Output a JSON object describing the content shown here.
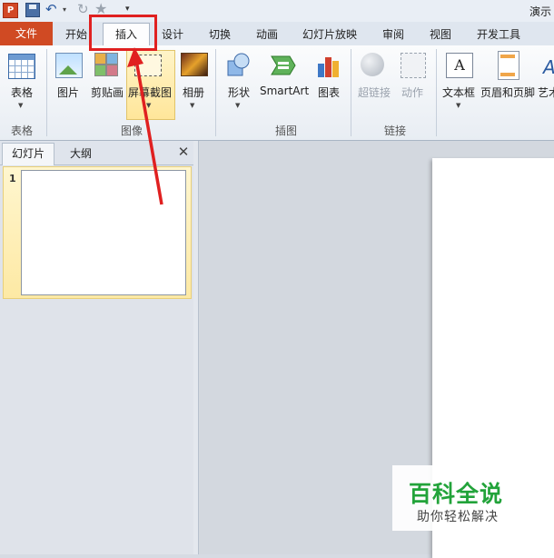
{
  "app": {
    "logo_letter": "P",
    "title": "演示"
  },
  "qat": {
    "undo_icon": "↶",
    "undo_dropdown_icon": "▾",
    "redo_icon": "↻",
    "star_icon": "★",
    "customize_icon": "▾"
  },
  "tabs": [
    {
      "label": "文件"
    },
    {
      "label": "开始"
    },
    {
      "label": "插入"
    },
    {
      "label": "设计"
    },
    {
      "label": "切换"
    },
    {
      "label": "动画"
    },
    {
      "label": "幻灯片放映"
    },
    {
      "label": "审阅"
    },
    {
      "label": "视图"
    },
    {
      "label": "开发工具"
    }
  ],
  "ribbon": {
    "table_label": "表格",
    "picture_label": "图片",
    "clipart_label": "剪贴画",
    "screenshot_label": "屏幕截图",
    "album_label": "相册",
    "shapes_label": "形状",
    "smartart_label": "SmartArt",
    "chart_label": "图表",
    "hyperlink_label": "超链接",
    "action_label": "动作",
    "textbox_label": "文本框",
    "headerfooter_label": "页眉和页脚",
    "wordart_label": "艺术字",
    "textbox_icon_text": "A",
    "groups": {
      "tables": "表格",
      "images": "图像",
      "illustrations": "插图",
      "links": "链接"
    }
  },
  "slide_panel": {
    "tab_slides": "幻灯片",
    "tab_outline": "大纲",
    "close_icon": "✕",
    "slide_number": "1"
  },
  "watermark": {
    "title": "百科全说",
    "subtitle": "助你轻松解决"
  },
  "colors": {
    "file_tab": "#d04a23",
    "annotation": "#e02020",
    "watermark_green": "#22a33a"
  }
}
